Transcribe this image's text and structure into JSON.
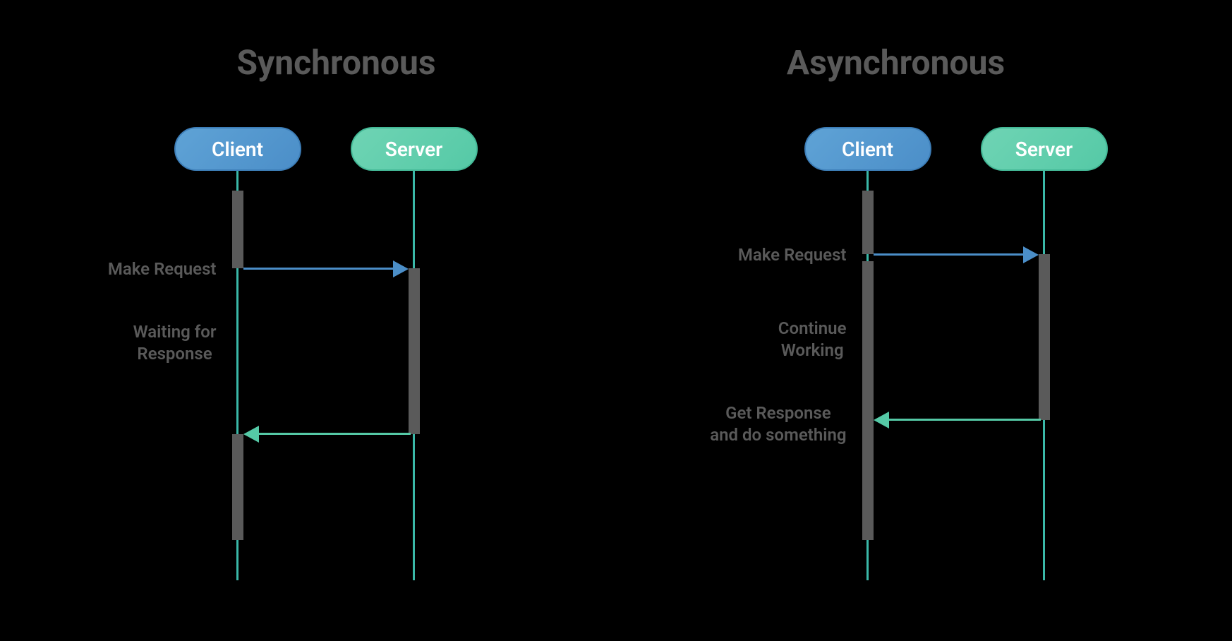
{
  "diagrams": {
    "sync": {
      "title": "Synchronous",
      "client_label": "Client",
      "server_label": "Server",
      "labels": {
        "make_request": "Make Request",
        "waiting": "Waiting for\nResponse"
      }
    },
    "async": {
      "title": "Asynchronous",
      "client_label": "Client",
      "server_label": "Server",
      "labels": {
        "make_request": "Make Request",
        "continue": "Continue\nWorking",
        "get_response": "Get Response\nand do something"
      }
    }
  },
  "colors": {
    "client_pill": "#4b8ec8",
    "server_pill": "#55c9a6",
    "arrow_blue": "#4b8ec8",
    "arrow_green": "#55c9a6",
    "activation": "#5a5a5a",
    "lifeline": "#3ab8a8",
    "text": "#5a5a5a"
  }
}
